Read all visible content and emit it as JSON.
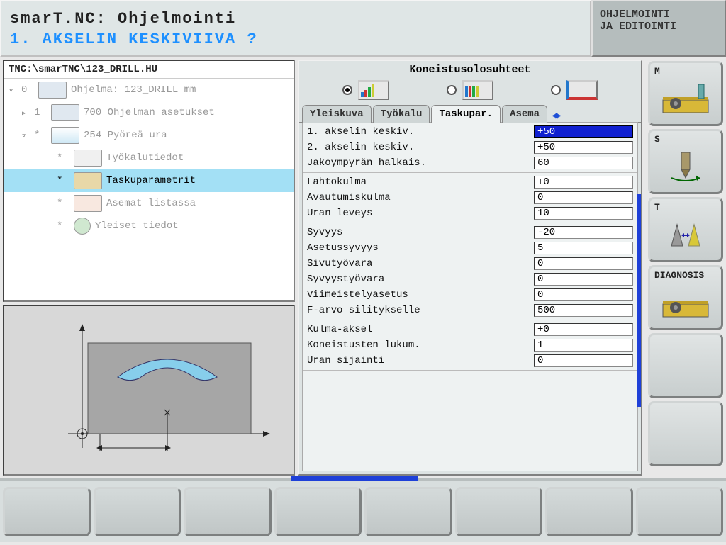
{
  "header": {
    "app_title": "smarT.NC: Ohjelmointi",
    "prompt": "1. AKSELIN KESKIVIIVA ?",
    "mode_line1": "OHJELMOINTI",
    "mode_line2": "JA EDITOINTI"
  },
  "tree": {
    "path": "TNC:\\smarTNC\\123_DRILL.HU",
    "items": [
      {
        "expand": "▿",
        "idx": "0",
        "label": "Ohjelma: 123_DRILL mm",
        "indent": "",
        "icon": "prog"
      },
      {
        "expand": "▹",
        "idx": "1",
        "label": "700 Ohjelman asetukset",
        "indent": "indent1",
        "icon": "settings"
      },
      {
        "expand": "▿",
        "idx": "*",
        "label": "254 Pyöreä ura",
        "indent": "indent1",
        "icon": "arc"
      },
      {
        "expand": "",
        "idx": "*",
        "label": "Työkalutiedot",
        "indent": "indent3",
        "icon": "tool"
      },
      {
        "expand": "",
        "idx": "*",
        "label": "Taskuparametrit",
        "indent": "indent3",
        "icon": "param",
        "selected": true
      },
      {
        "expand": "",
        "idx": "*",
        "label": "Asemat listassa",
        "indent": "indent3",
        "icon": "pos"
      },
      {
        "expand": "",
        "idx": "*",
        "label": "Yleiset tiedot",
        "indent": "indent3",
        "icon": "globe"
      }
    ]
  },
  "form": {
    "section_title": "Koneistusolosuhteet",
    "tabs": [
      "Yleiskuva",
      "Työkalu",
      "Taskupar.",
      "Asema"
    ],
    "active_tab": 2,
    "groups": [
      [
        {
          "label": "1. akselin keskiv.",
          "value": "+50",
          "active": true
        },
        {
          "label": "2. akselin keskiv.",
          "value": "+50"
        },
        {
          "label": "Jakoympyrän halkais.",
          "value": "60"
        }
      ],
      [
        {
          "label": "Lahtokulma",
          "value": "+0"
        },
        {
          "label": "Avautumiskulma",
          "value": "0"
        },
        {
          "label": "Uran leveys",
          "value": "10"
        }
      ],
      [
        {
          "label": "Syvyys",
          "value": "-20"
        },
        {
          "label": "Asetussyvyys",
          "value": "5"
        },
        {
          "label": "Sivutyövara",
          "value": "0"
        },
        {
          "label": "Syvyystyövara",
          "value": "0"
        },
        {
          "label": "Viimeistelyasetus",
          "value": "0"
        },
        {
          "label": "F-arvo silitykselle",
          "value": "500"
        }
      ],
      [
        {
          "label": "Kulma-aksel",
          "value": "+0"
        },
        {
          "label": "Koneistusten lukum.",
          "value": "1"
        },
        {
          "label": "Uran sijainti",
          "value": "0"
        }
      ]
    ]
  },
  "side": [
    "M",
    "S",
    "T",
    "DIAGNOSIS"
  ]
}
